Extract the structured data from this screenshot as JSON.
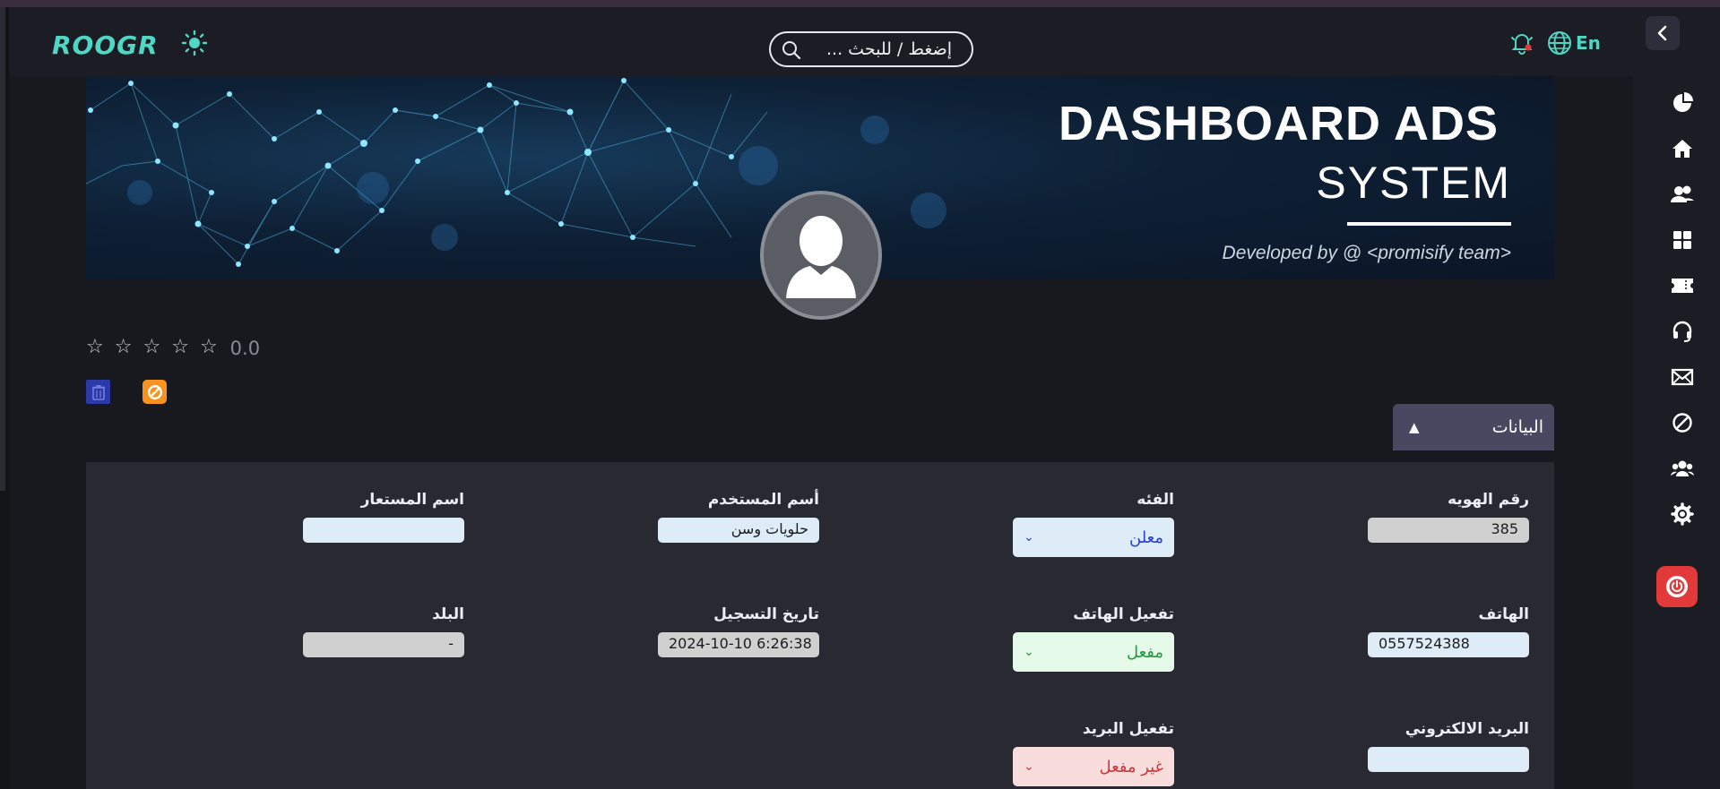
{
  "header": {
    "logo_text": "ROOGR",
    "search_placeholder": "إضغط / للبحث ...",
    "language_label": "En",
    "accent_color": "#4fd6c4"
  },
  "sidebar": {
    "items": [
      {
        "name": "pie-chart-icon"
      },
      {
        "name": "home-icon"
      },
      {
        "name": "users-icon"
      },
      {
        "name": "grid-icon"
      },
      {
        "name": "ticket-icon"
      },
      {
        "name": "headset-icon"
      },
      {
        "name": "mail-icon"
      },
      {
        "name": "block-icon"
      },
      {
        "name": "team-icon"
      },
      {
        "name": "settings-icon"
      }
    ],
    "logout_icon": "power-icon"
  },
  "banner": {
    "title": "DASHBOARD ADS",
    "subtitle": "SYSTEM",
    "credit": "Developed by @ <promisify team>"
  },
  "profile": {
    "rating": "0.0",
    "stars_total": 5,
    "stars_filled": 0,
    "stars": [
      "☆",
      "☆",
      "☆",
      "☆",
      "☆"
    ]
  },
  "section": {
    "tab_label": "البيانات",
    "tab_arrow": "▲"
  },
  "fields": {
    "id_number": {
      "label": "رقم الهويه",
      "value": "385"
    },
    "category": {
      "label": "الفئه",
      "value": "معلن"
    },
    "username": {
      "label": "أسم المستخدم",
      "value": "حلويات وسن"
    },
    "alias": {
      "label": "اسم المستعار",
      "value": ""
    },
    "phone": {
      "label": "الهاتف",
      "value": "0557524388"
    },
    "phone_activation": {
      "label": "تفعيل الهاتف",
      "value": "مفعل"
    },
    "registration_date": {
      "label": "تاريخ التسجيل",
      "value": "2024-10-10 6:26:38"
    },
    "country": {
      "label": "البلد",
      "value": "-"
    },
    "email": {
      "label": "البريد الالكتروني",
      "value": ""
    },
    "email_activation": {
      "label": "تفعيل البريد",
      "value": "غير مفعل"
    }
  },
  "select_chevron": "⌄"
}
